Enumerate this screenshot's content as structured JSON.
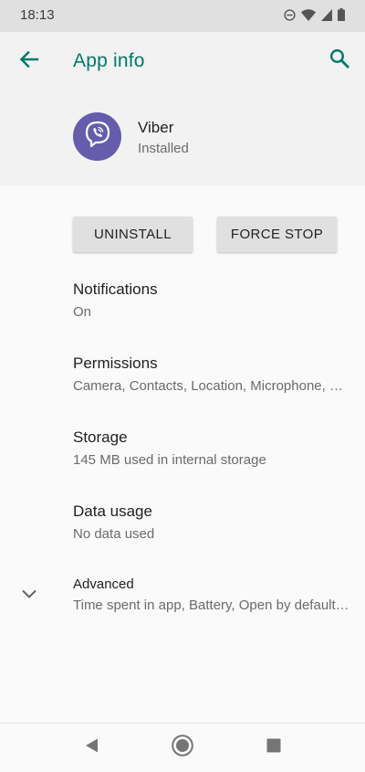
{
  "status_bar": {
    "time": "18:13",
    "icons": [
      "do-not-disturb-icon",
      "wifi-icon",
      "signal-icon",
      "battery-icon"
    ]
  },
  "app_bar": {
    "title": "App info",
    "back_icon": "arrow-back-icon",
    "search_icon": "search-icon",
    "accent_color": "#00796b"
  },
  "app": {
    "name": "Viber",
    "status": "Installed",
    "icon": "viber-logo",
    "brand_color": "#665cac"
  },
  "actions": {
    "uninstall_label": "UNINSTALL",
    "force_stop_label": "FORCE STOP"
  },
  "settings": [
    {
      "title": "Notifications",
      "summary": "On"
    },
    {
      "title": "Permissions",
      "summary": "Camera, Contacts, Location, Microphone, …"
    },
    {
      "title": "Storage",
      "summary": "145 MB used in internal storage"
    },
    {
      "title": "Data usage",
      "summary": "No data used"
    }
  ],
  "advanced": {
    "title": "Advanced",
    "summary": "Time spent in app, Battery, Open by default…",
    "expand_icon": "chevron-down-icon"
  },
  "nav_bar": {
    "icons": [
      "nav-back-icon",
      "nav-home-icon",
      "nav-recents-icon"
    ]
  }
}
